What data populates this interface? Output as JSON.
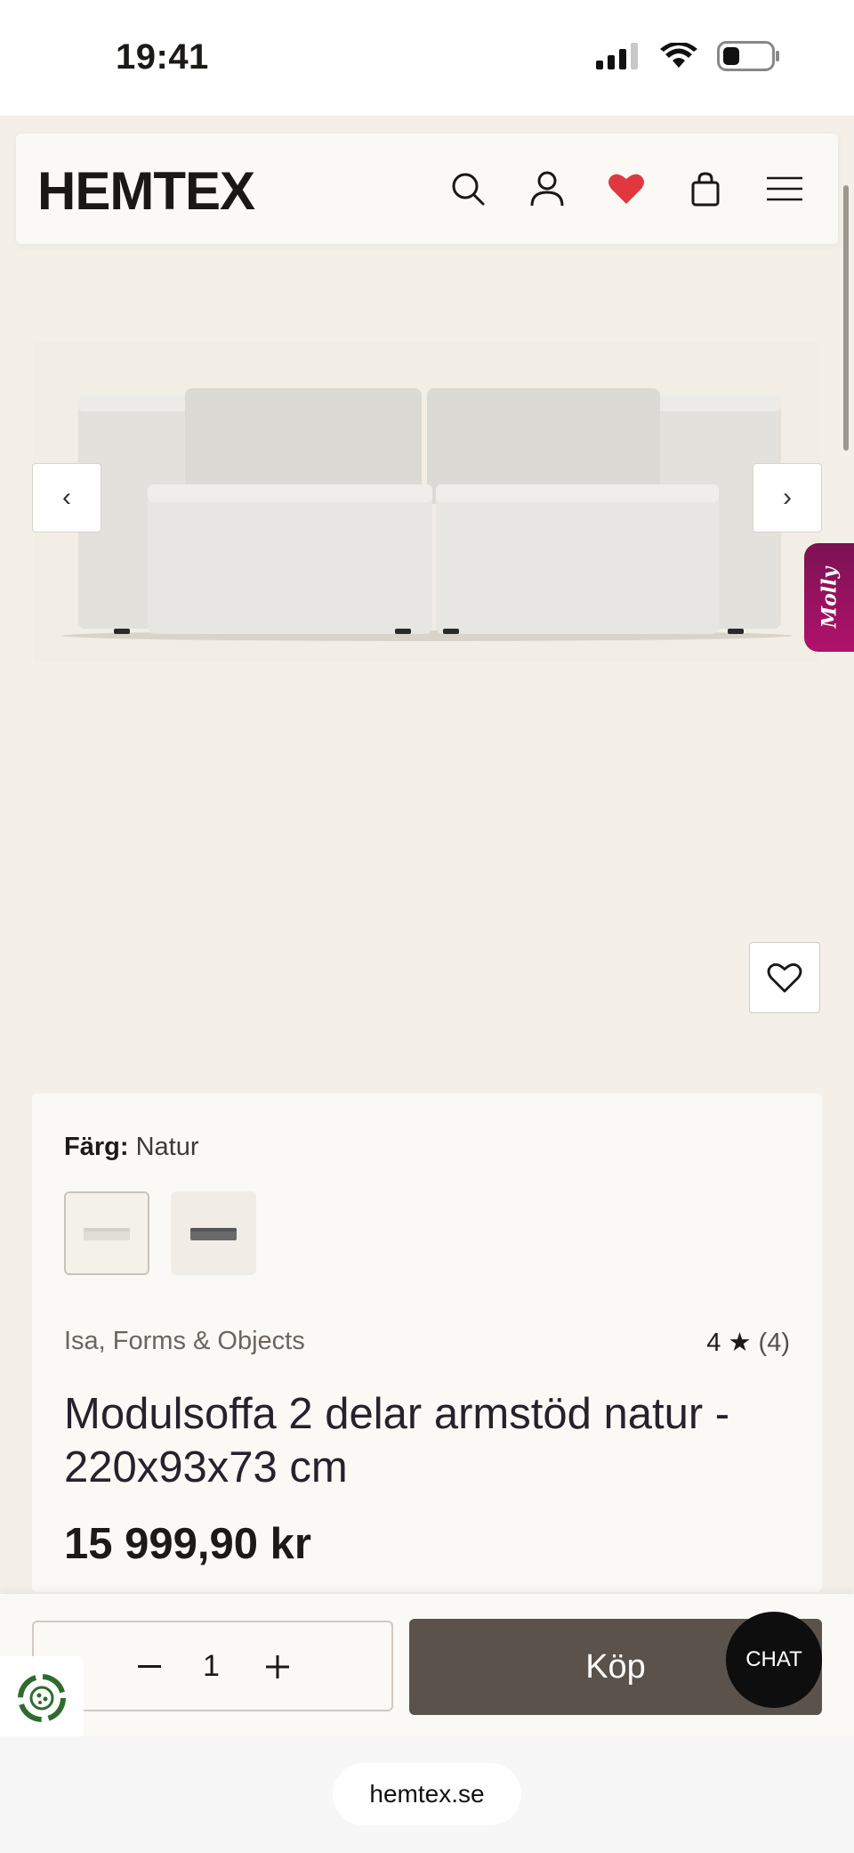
{
  "status_bar": {
    "time": "19:41"
  },
  "header": {
    "logo": "HEMTEX"
  },
  "gallery": {
    "prev_glyph": "‹",
    "next_glyph": "›",
    "molly_label": "Molly"
  },
  "product": {
    "color_label": "Färg:",
    "color_value": "Natur",
    "brand": "Isa, Forms & Objects",
    "rating_value": "4 ★",
    "rating_count": "(4)",
    "title": "Modulsoffa 2 delar armstöd natur - 220x93x73 cm",
    "price": "15 999,90 kr",
    "swatch_colors": [
      "#e4e0d8",
      "#6a6a6a"
    ]
  },
  "buy_bar": {
    "quantity": "1",
    "buy_label": "Köp",
    "chat_label": "CHAT"
  },
  "browser": {
    "url": "hemtex.se"
  },
  "colors": {
    "page_bg": "#f4f0e9",
    "buy_button": "#5a524b",
    "heart_active": "#e0383e",
    "molly": "#a0125f"
  }
}
